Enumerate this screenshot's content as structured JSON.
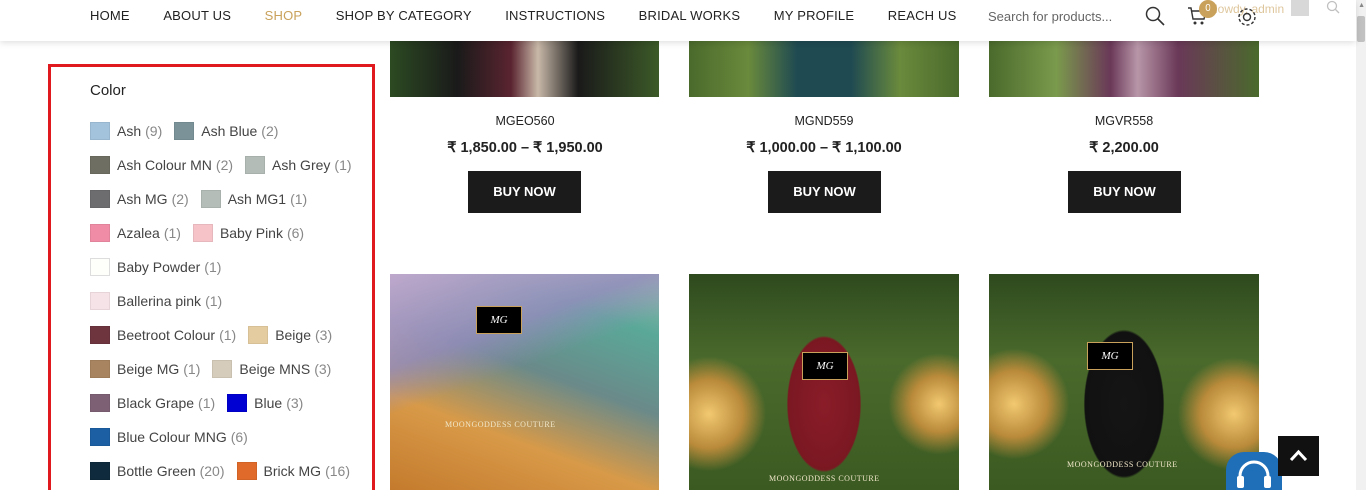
{
  "nav": {
    "items": [
      "HOME",
      "ABOUT US",
      "SHOP",
      "SHOP BY CATEGORY",
      "INSTRUCTIONS",
      "BRIDAL WORKS",
      "MY PROFILE",
      "REACH US"
    ],
    "active": "SHOP"
  },
  "header": {
    "search_placeholder": "Search for products...",
    "cart_count": "0",
    "user_text": "Howdy, admin"
  },
  "sidebar": {
    "title": "Color",
    "colors": [
      {
        "name": "Ash",
        "count": "(9)",
        "swatch": "#a3c2dc"
      },
      {
        "name": "Ash Blue",
        "count": "(2)",
        "swatch": "#7a9298"
      },
      {
        "name": "Ash Colour MN",
        "count": "(2)",
        "swatch": "#6e6e62"
      },
      {
        "name": "Ash Grey",
        "count": "(1)",
        "swatch": "#b3bcb6"
      },
      {
        "name": "Ash MG",
        "count": "(2)",
        "swatch": "#6d6c6e"
      },
      {
        "name": "Ash MG1",
        "count": "(1)",
        "swatch": "#b4bdb7"
      },
      {
        "name": "Azalea",
        "count": "(1)",
        "swatch": "#f08ca5"
      },
      {
        "name": "Baby Pink",
        "count": "(6)",
        "swatch": "#f5c3c8"
      },
      {
        "name": "Baby Powder",
        "count": "(1)",
        "swatch": "#fefefa"
      },
      {
        "name": "Ballerina pink",
        "count": "(1)",
        "swatch": "#f5e3e8"
      },
      {
        "name": "Beetroot Colour",
        "count": "(1)",
        "swatch": "#6e353f"
      },
      {
        "name": "Beige",
        "count": "(3)",
        "swatch": "#e5cba0"
      },
      {
        "name": "Beige MG",
        "count": "(1)",
        "swatch": "#a88460"
      },
      {
        "name": "Beige MNS",
        "count": "(3)",
        "swatch": "#d6ccbc"
      },
      {
        "name": "Black Grape",
        "count": "(1)",
        "swatch": "#7e6075"
      },
      {
        "name": "Blue",
        "count": "(3)",
        "swatch": "#0000d2"
      },
      {
        "name": "Blue Colour MNG",
        "count": "(6)",
        "swatch": "#1c5fa3"
      },
      {
        "name": "Bottle Green",
        "count": "(20)",
        "swatch": "#0e2a3c"
      },
      {
        "name": "Brick MG",
        "count": "(16)",
        "swatch": "#e06a2a"
      }
    ]
  },
  "products": [
    {
      "title": "MGEO560",
      "price": "₹ 1,850.00 – ₹ 1,950.00",
      "button": "BUY NOW"
    },
    {
      "title": "MGND559",
      "price": "₹ 1,000.00 – ₹ 1,100.00",
      "button": "BUY NOW"
    },
    {
      "title": "MGVR558",
      "price": "₹ 2,200.00",
      "button": "BUY NOW"
    }
  ],
  "watermark": "MOONGODDESS COUTURE",
  "logo_text": "MG"
}
